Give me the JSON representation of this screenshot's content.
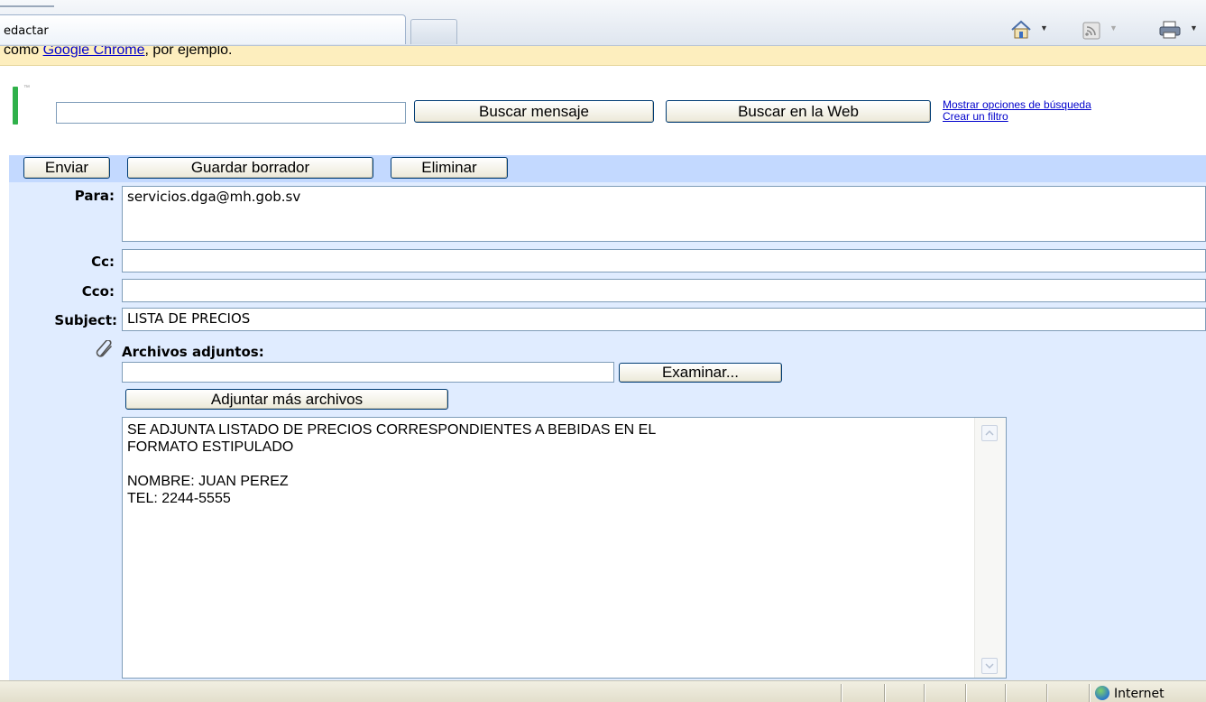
{
  "browser": {
    "tab_title": "edactar",
    "icons": [
      "home-icon",
      "feeds-icon",
      "print-icon"
    ]
  },
  "infobar": {
    "prefix": "como ",
    "link": "Google Chrome",
    "suffix": ", por ejemplo."
  },
  "search": {
    "input_value": "",
    "buscar_mensaje": "Buscar mensaje",
    "buscar_web": "Buscar en la Web",
    "link_options": "Mostrar opciones de búsqueda",
    "link_filter": "Crear un filtro"
  },
  "compose": {
    "toolbar": {
      "send": "Enviar",
      "save_draft": "Guardar borrador",
      "delete": "Eliminar"
    },
    "to_label": "Para:",
    "to_value": "servicios.dga@mh.gob.sv",
    "cc_label": "Cc:",
    "cc_value": "",
    "bcc_label": "Cco:",
    "bcc_value": "",
    "subject_label": "Subject:",
    "subject_value": "LISTA DE PRECIOS",
    "attachments_label": "Archivos adjuntos:",
    "file_value": "",
    "browse_button": "Examinar...",
    "attach_more_button": "Adjuntar más archivos",
    "body_lines": [
      "SE ADJUNTA LISTADO DE PRECIOS CORRESPONDIENTES A BEBIDAS EN EL",
      "FORMATO ESTIPULADO",
      "",
      "NOMBRE: JUAN PEREZ",
      "TEL: 2244-5555"
    ]
  },
  "statusbar": {
    "zone": "Internet"
  },
  "colors": {
    "compose_bg": "#e0ecff",
    "toolbar_bg": "#c3d9ff",
    "infobar_bg": "#fdeebe",
    "link": "#0000cc"
  }
}
